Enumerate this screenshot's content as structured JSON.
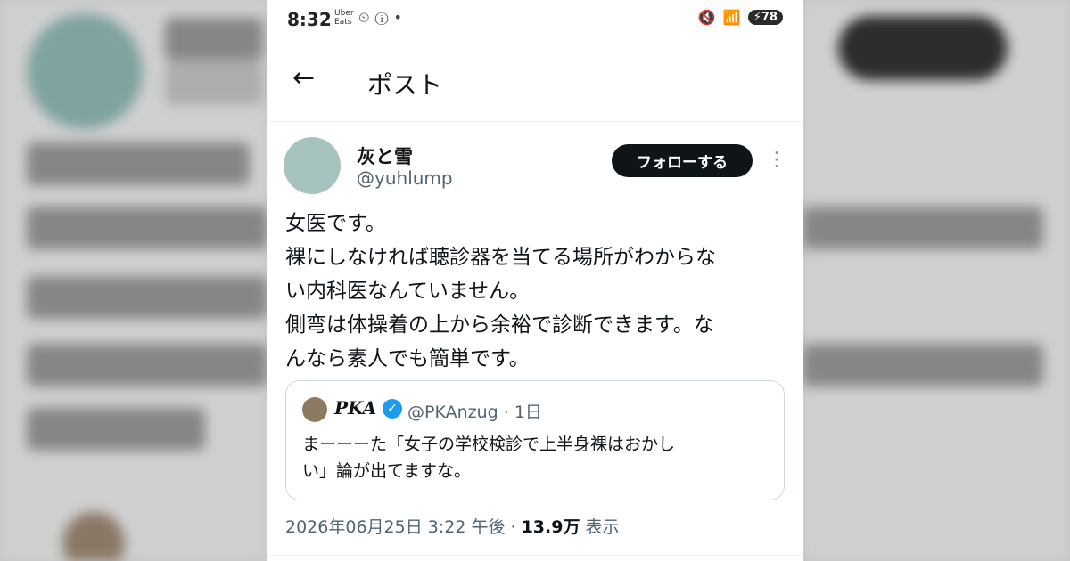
{
  "status_bar": {
    "time": "8:32",
    "app_label": "Uber Eats",
    "battery": "78"
  },
  "header": {
    "back_icon": "arrow-left-icon",
    "title": "ポスト"
  },
  "author": {
    "display_name": "灰と雪",
    "handle": "@yuhlump",
    "follow_label": "フォローする",
    "avatar_color": "#a7c3c0"
  },
  "post": {
    "lines": [
      "女医です。",
      "裸にしなければ聴診器を当てる場所がわからな",
      "い内科医なんていません。",
      "側弯は体操着の上から余裕で診断できます。な",
      "んなら素人でも簡単です。"
    ]
  },
  "quote": {
    "name": "PKA",
    "verified_color": "#1d9bf0",
    "handle_time": "@PKAnzug · 1日",
    "lines": [
      "まーーーた「女子の学校検診で上半身裸はおかし",
      "い」論が出てますな。"
    ]
  },
  "meta": {
    "timestamp": "2026年06月25日 3:22 午後 · ",
    "views_count": "13.9万",
    "views_label": " 表示"
  }
}
